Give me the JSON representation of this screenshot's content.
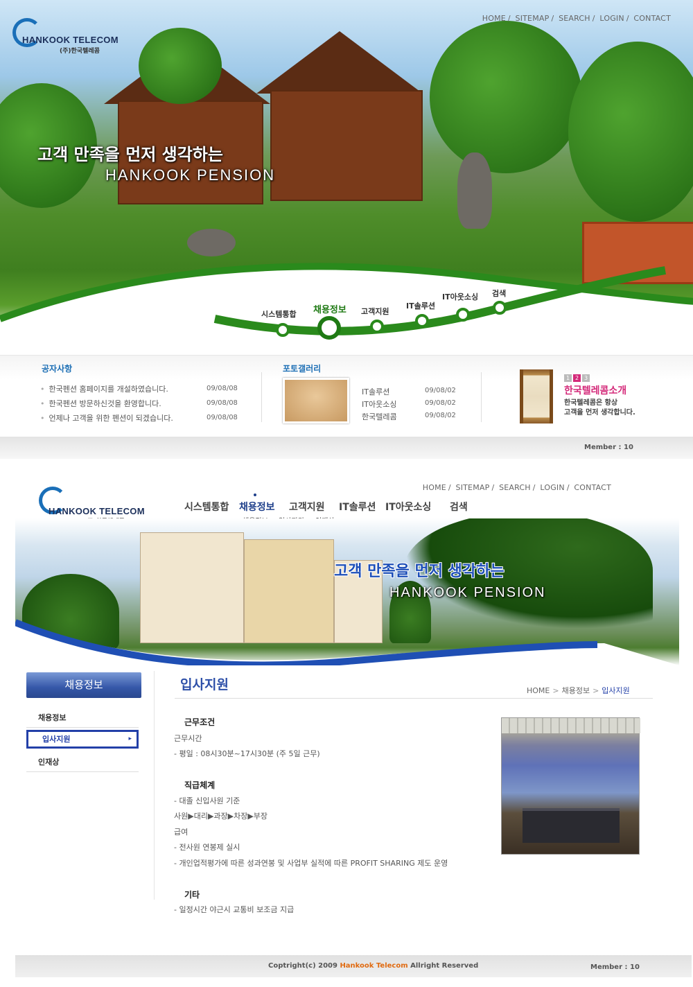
{
  "site": {
    "logo_en": "HANKOOK TELECOM",
    "logo_ko": "(주)한국텔레콤",
    "top_links": [
      "HOME",
      "SITEMAP",
      "SEARCH",
      "LOGIN",
      "CONTACT"
    ],
    "slogan_line1": "고객 만족을 먼저 생각하는",
    "slogan_line2": "HANKOOK PENSION"
  },
  "nav": {
    "items": [
      "시스템통합",
      "채용정보",
      "고객지원",
      "IT솔루션",
      "IT아웃소싱",
      "검색"
    ],
    "active": "채용정보",
    "sub_items": [
      "채용정보",
      "입사지원",
      "인재상"
    ]
  },
  "notice": {
    "title": "공자사항",
    "items": [
      {
        "text": "한국펜션 홈페이지를 개설하였습니다.",
        "date": "09/08/08"
      },
      {
        "text": "한국펜션 방문하신것을 환영합니다.",
        "date": "09/08/08"
      },
      {
        "text": "언제나 고객을 위한 펜션이 되겠습니다.",
        "date": "09/08/08"
      }
    ]
  },
  "gallery": {
    "title": "포토갤러리",
    "items": [
      {
        "text": "IT솔루션",
        "date": "09/08/02"
      },
      {
        "text": "IT아웃소싱",
        "date": "09/08/02"
      },
      {
        "text": "한국텔레콤",
        "date": "09/08/02"
      }
    ]
  },
  "intro": {
    "pages": [
      "1",
      "2",
      "3"
    ],
    "active_page": "2",
    "title": "한국텔레콤소개",
    "desc_line1": "한국텔레콤은 항상",
    "desc_line2": "고객을 먼저 생각합니다."
  },
  "member": "Member : 10",
  "sub": {
    "side_title": "채용정보",
    "side_items": [
      "채용정보",
      "입사지원",
      "인재상"
    ],
    "side_active": "입사지원",
    "page_title": "입사지원",
    "breadcrumb": [
      "HOME",
      "채용정보",
      "입사지원"
    ],
    "sections": [
      {
        "heading": "근무조건",
        "lines": [
          "근무시간",
          "- 평일 : 08시30분~17시30분 (주 5일 근무)"
        ]
      },
      {
        "heading": "직급체계",
        "lines": [
          "- 대졸 신입사원 기준",
          "사원▶대리▶과장▶차장▶부장",
          "급여",
          "- 전사원 연봉제 실시",
          "- 개인업적평가에 따른 성과연봉 및 사업부 실적에 따른 PROFIT SHARING 제도 운영"
        ]
      },
      {
        "heading": "기타",
        "lines": [
          "- 일정시간 야근시 교통비 보조금 지급"
        ]
      }
    ]
  },
  "footer": {
    "copy_prefix": "Coptright(c) 2009 ",
    "copy_brand": "Hankook Telecom",
    "copy_suffix": " Allright Reserved",
    "member": "Member : 10"
  },
  "colors": {
    "green": "#1f7a14",
    "blue": "#2340a8",
    "pink": "#d42a7a",
    "orange": "#e06a10"
  }
}
